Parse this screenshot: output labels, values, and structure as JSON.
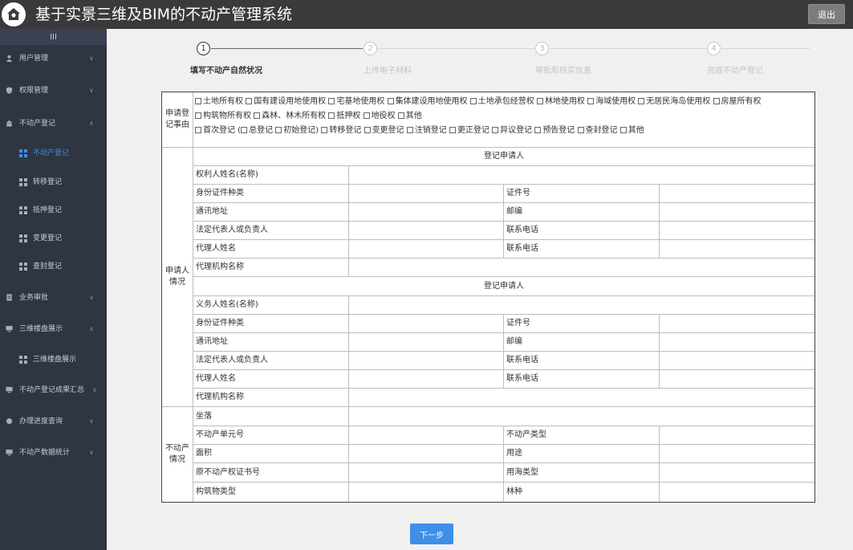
{
  "header": {
    "title": "基于实景三维及BIM的不动产管理系统",
    "logout": "退出"
  },
  "sidebar": {
    "collapse": "III",
    "items": [
      {
        "label": "用户管理",
        "icon": "user-icon"
      },
      {
        "label": "权限管理",
        "icon": "shield-icon"
      },
      {
        "label": "不动产登记",
        "icon": "building-icon",
        "children": [
          "不动产登记",
          "转移登记",
          "抵押登记",
          "变更登记",
          "查封登记"
        ]
      },
      {
        "label": "业务审批",
        "icon": "document-icon"
      },
      {
        "label": "三维楼盘展示",
        "icon": "monitor-icon",
        "children": [
          "三维楼盘展示"
        ]
      },
      {
        "label": "不动产登记成果汇总",
        "icon": "monitor-icon"
      },
      {
        "label": "办理进度查询",
        "icon": "dot-icon"
      },
      {
        "label": "不动产数据统计",
        "icon": "monitor-icon"
      }
    ]
  },
  "steps": [
    {
      "num": "1",
      "label": "填写不动产自然状况"
    },
    {
      "num": "2",
      "label": "上传电子材料"
    },
    {
      "num": "3",
      "label": "审批和核实信息"
    },
    {
      "num": "4",
      "label": "完成不动产登记"
    }
  ],
  "form": {
    "reason_label": "申请登记事由",
    "rights": [
      "土地所有权",
      "国有建设用地使用权",
      "宅基地使用权",
      "集体建设用地使用权",
      "土地承包经营权",
      "林地使用权",
      "海域使用权",
      "无居民海岛使用权",
      "房屋所有权",
      "构筑物所有权",
      "森林、林木所有权",
      "抵押权",
      "地役权",
      "其他"
    ],
    "types_prefix": "首次登记 (",
    "types_inner": [
      "总登记",
      "初始登记)"
    ],
    "types": [
      "转移登记",
      "变更登记",
      "注销登记",
      "更正登记",
      "异议登记",
      "预告登记",
      "查封登记",
      "其他"
    ],
    "applicant_label": "申请人情况",
    "section1_title": "登记申请人",
    "section2_title": "登记申请人",
    "rightholder_name": "权利人姓名(名称)",
    "obligor_name": "义务人姓名(名称)",
    "id_type": "身份证件种类",
    "id_no": "证件号",
    "address": "通讯地址",
    "postcode": "邮编",
    "legal_rep": "法定代表人或负责人",
    "phone": "联系电话",
    "agent_name": "代理人姓名",
    "agency_name": "代理机构名称",
    "property_label": "不动产情况",
    "location": "坐落",
    "unit_no": "不动产单元号",
    "property_type": "不动产类型",
    "area": "面积",
    "usage": "用途",
    "old_cert": "原不动产权证书号",
    "sea_type": "用海类型",
    "structure_type": "构筑物类型",
    "forest_type": "林种"
  },
  "next_button": "下一步"
}
